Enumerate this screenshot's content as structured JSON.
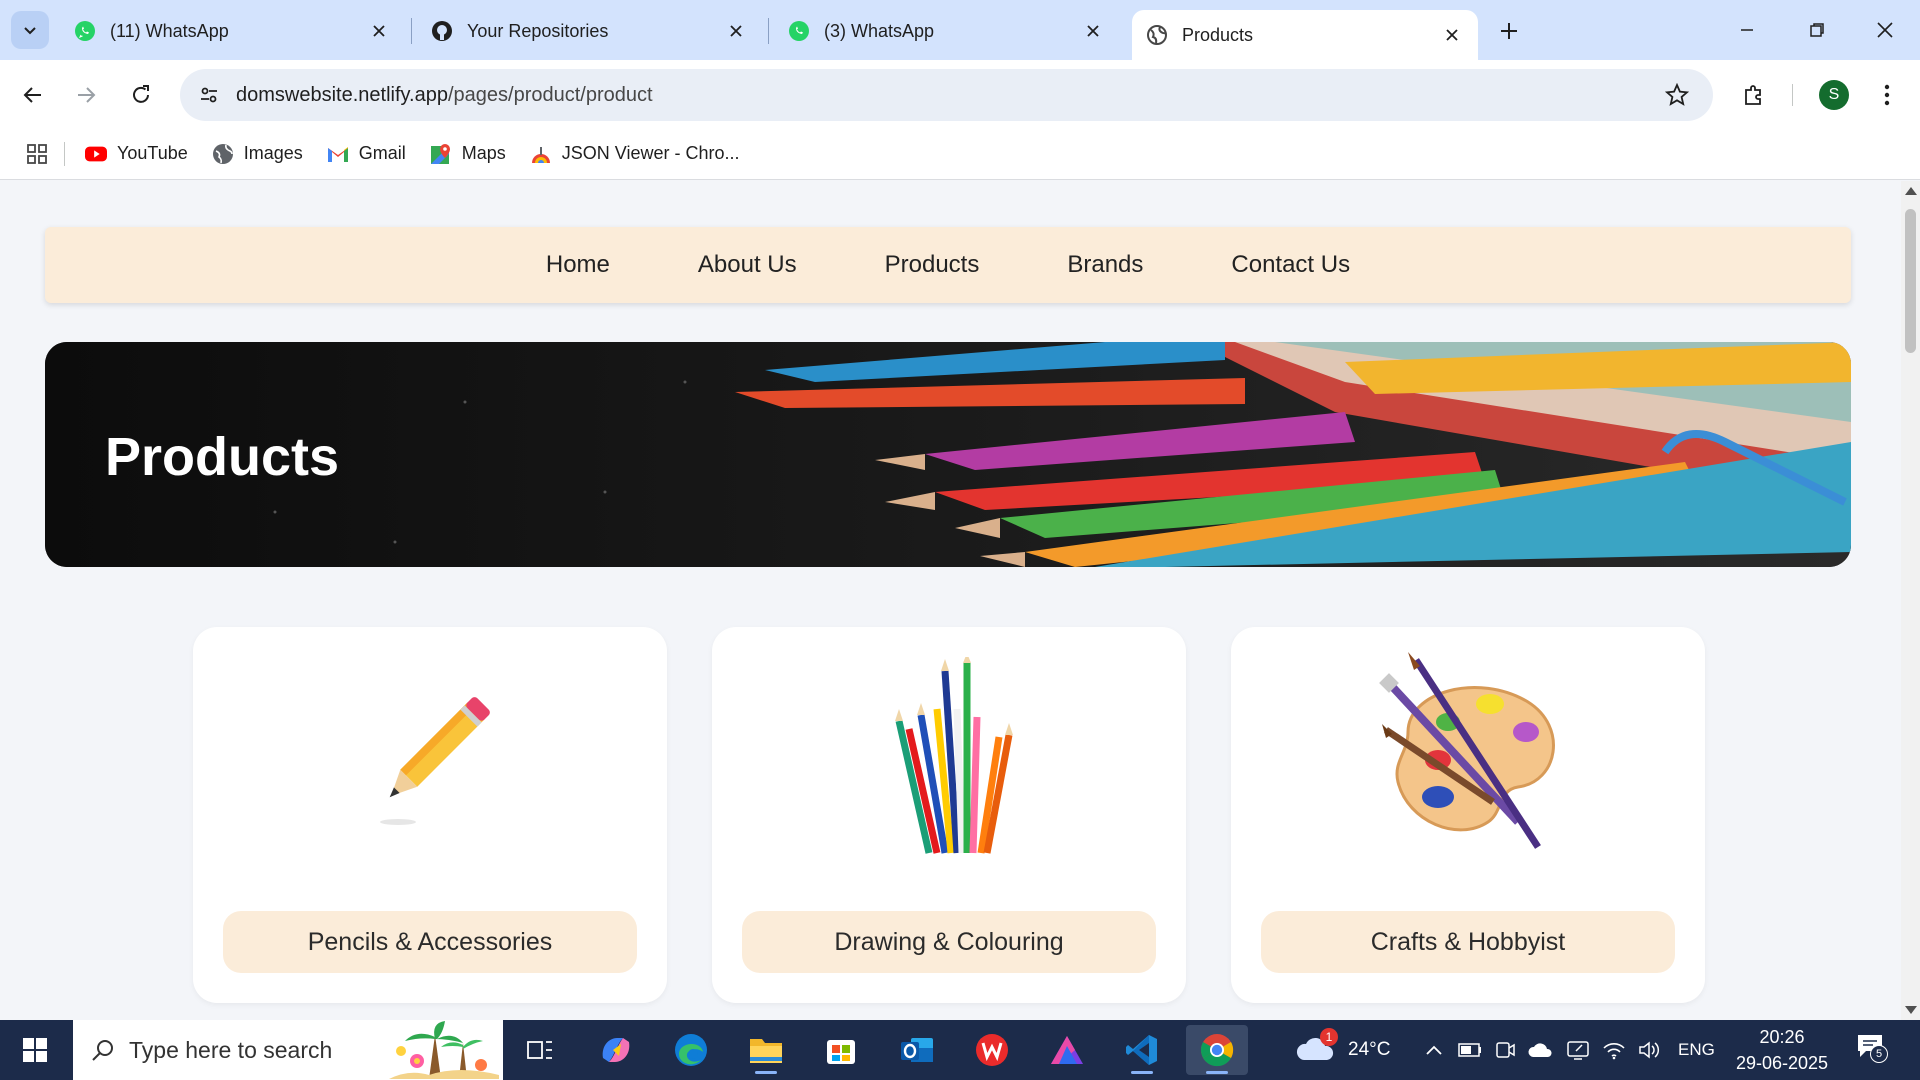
{
  "browser": {
    "tabs": [
      {
        "title": "(11) WhatsApp",
        "favicon": "whatsapp-icon"
      },
      {
        "title": "Your Repositories",
        "favicon": "github-icon"
      },
      {
        "title": "(3) WhatsApp",
        "favicon": "whatsapp-icon"
      },
      {
        "title": "Products",
        "favicon": "globe-icon",
        "active": true
      }
    ],
    "url_host": "domswebsite.netlify.app",
    "url_path": "/pages/product/product",
    "profile_initial": "S",
    "bookmarks": [
      {
        "label": "YouTube",
        "icon": "youtube-icon"
      },
      {
        "label": "Images",
        "icon": "images-icon"
      },
      {
        "label": "Gmail",
        "icon": "gmail-icon"
      },
      {
        "label": "Maps",
        "icon": "maps-icon"
      },
      {
        "label": "JSON Viewer - Chro...",
        "icon": "json-viewer-icon"
      }
    ]
  },
  "site": {
    "nav": [
      "Home",
      "About Us",
      "Products",
      "Brands",
      "Contact Us"
    ],
    "hero_title": "Products",
    "categories": [
      {
        "label": "Pencils & Accessories",
        "icon": "pencil-icon"
      },
      {
        "label": "Drawing & Colouring",
        "icon": "colour-pencils-icon"
      },
      {
        "label": "Crafts & Hobbyist",
        "icon": "paint-palette-icon"
      }
    ]
  },
  "taskbar": {
    "search_placeholder": "Type here to search",
    "weather_temp": "24°C",
    "weather_badge": "1",
    "language": "ENG",
    "time": "20:26",
    "date": "29-06-2025",
    "notification_count": "5"
  },
  "colors": {
    "tabstrip": "#d3e3fd",
    "nav_bg": "#fbecd9",
    "page_bg": "#f3f5f9",
    "taskbar": "#1c2b4a"
  }
}
